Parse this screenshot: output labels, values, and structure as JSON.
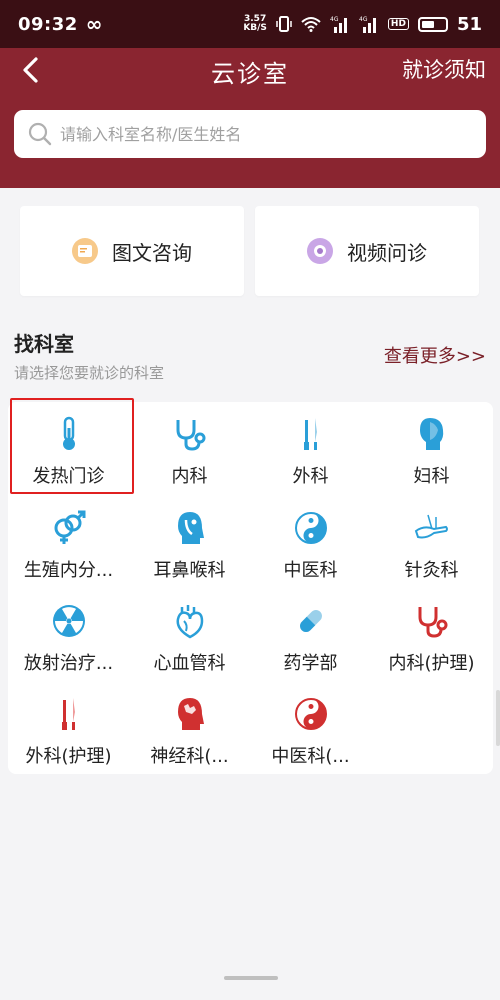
{
  "status_bar": {
    "time": "09:32",
    "infinity": "∞",
    "speed_value": "3.57",
    "speed_unit": "KB/S",
    "hd": "HD",
    "battery": "51"
  },
  "header": {
    "title": "云诊室",
    "notice": "就诊须知"
  },
  "search": {
    "placeholder": "请输入科室名称/医生姓名"
  },
  "consult": {
    "text_label": "图文咨询",
    "video_label": "视频问诊"
  },
  "section": {
    "title": "找科室",
    "subtitle": "请选择您要就诊的科室",
    "more": "查看更多>>"
  },
  "departments": [
    {
      "label": "发热门诊",
      "icon": "thermometer-icon"
    },
    {
      "label": "内科",
      "icon": "stethoscope-icon"
    },
    {
      "label": "外科",
      "icon": "scalpel-icon"
    },
    {
      "label": "妇科",
      "icon": "woman-head-icon"
    },
    {
      "label": "生殖内分...",
      "icon": "gender-icon"
    },
    {
      "label": "耳鼻喉科",
      "icon": "ent-head-icon"
    },
    {
      "label": "中医科",
      "icon": "yin-yang-icon"
    },
    {
      "label": "针灸科",
      "icon": "acupuncture-icon"
    },
    {
      "label": "放射治疗...",
      "icon": "radiation-icon"
    },
    {
      "label": "心血管科",
      "icon": "heart-icon"
    },
    {
      "label": "药学部",
      "icon": "pill-icon"
    },
    {
      "label": "内科(护理)",
      "icon": "stethoscope-red-icon"
    },
    {
      "label": "外科(护理)",
      "icon": "scalpel-red-icon"
    },
    {
      "label": "神经科(...",
      "icon": "brain-head-icon"
    },
    {
      "label": "中医科(...",
      "icon": "yin-yang-red-icon"
    }
  ],
  "colors": {
    "header": "#8a2530",
    "status_bar": "#3a0f14",
    "accent_blue": "#2a9fd8",
    "accent_red": "#d03030",
    "highlight": "#e02020"
  }
}
